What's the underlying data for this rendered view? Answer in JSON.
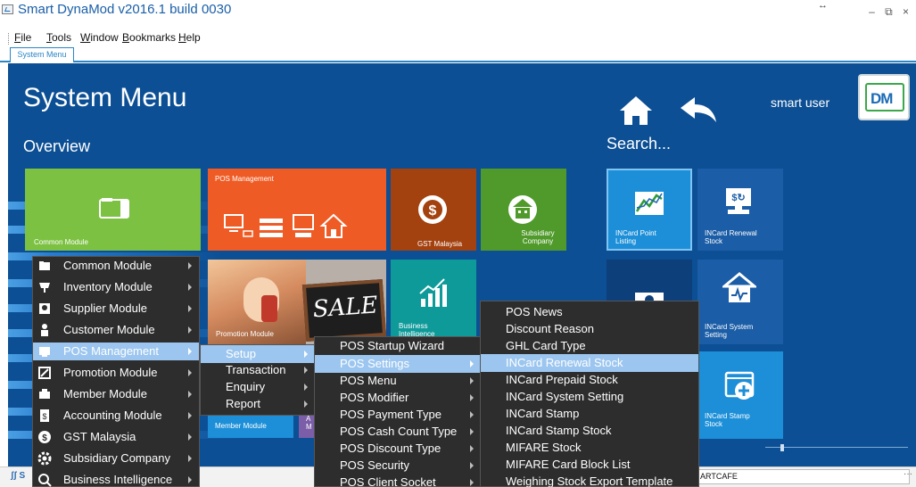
{
  "window": {
    "title": "Smart DynaMod v2016.1 build 0030",
    "resize_glyph": "↔",
    "controls": "– ⧉ ×"
  },
  "menubar": {
    "items": [
      {
        "label": "File",
        "u": "F",
        "rest": "ile"
      },
      {
        "label": "Tools",
        "u": "T",
        "rest": "ools"
      },
      {
        "label": "Window",
        "u": "W",
        "rest": "indow"
      },
      {
        "label": "Bookmarks",
        "u": "B",
        "rest": "ookmarks"
      },
      {
        "label": "Help",
        "u": "H",
        "rest": "elp"
      }
    ]
  },
  "tabs": [
    "System Menu"
  ],
  "header": {
    "title": "System Menu",
    "overview": "Overview",
    "search": "Search...",
    "user": "smart user",
    "logo_text": "DM"
  },
  "tiles": {
    "common_module": "Common Module",
    "pos_management": "POS Management",
    "gst_malaysia": "GST Malaysia",
    "subsidiary_company_1": "Subsidiary",
    "subsidiary_company_2": "Company",
    "incard_point_1": "INCard Point",
    "incard_point_2": "Listing",
    "incard_renewal_1": "INCard Renewal",
    "incard_renewal_2": "Stock",
    "promotion_module": "Promotion Module",
    "sale_sign": "SALE",
    "business_1": "Business",
    "business_2": "Intelligence",
    "incard_system_1": "INCard System",
    "incard_system_2": "Setting",
    "incard_stamp_1": "INCard Stamp",
    "incard_stamp_2": "Stock",
    "member_module": "Member Module",
    "partial_a": "A",
    "partial_m": "M"
  },
  "menu_main": {
    "items": [
      {
        "label": "Common Module",
        "icon": "folder-icon"
      },
      {
        "label": "Inventory Module",
        "icon": "cart-icon"
      },
      {
        "label": "Supplier Module",
        "icon": "supplier-icon"
      },
      {
        "label": "Customer Module",
        "icon": "person-icon"
      },
      {
        "label": "POS Management",
        "icon": "pos-icon",
        "selected": true
      },
      {
        "label": "Promotion Module",
        "icon": "promotion-icon"
      },
      {
        "label": "Member Module",
        "icon": "member-icon"
      },
      {
        "label": "Accounting Module",
        "icon": "accounting-icon"
      },
      {
        "label": "GST Malaysia",
        "icon": "dollar-icon"
      },
      {
        "label": "Subsidiary Company",
        "icon": "gear-icon"
      },
      {
        "label": "Business Intelligence",
        "icon": "bi-icon"
      }
    ]
  },
  "menu_pos": {
    "items": [
      {
        "label": "Setup",
        "selected": true
      },
      {
        "label": "Transaction"
      },
      {
        "label": "Enquiry"
      },
      {
        "label": "Report"
      }
    ]
  },
  "menu_setup": {
    "items": [
      {
        "label": "POS Startup Wizard"
      },
      {
        "label": "POS Settings",
        "selected": true
      },
      {
        "label": "POS Menu"
      },
      {
        "label": "POS Modifier"
      },
      {
        "label": "POS Payment Type"
      },
      {
        "label": "POS Cash Count Type"
      },
      {
        "label": "POS Discount Type"
      },
      {
        "label": "POS Security"
      },
      {
        "label": "POS Client Socket"
      }
    ]
  },
  "menu_settings": {
    "items": [
      {
        "label": "POS News"
      },
      {
        "label": "Discount Reason"
      },
      {
        "label": "GHL Card Type"
      },
      {
        "label": "INCard Renewal Stock",
        "selected": true
      },
      {
        "label": "INCard Prepaid Stock"
      },
      {
        "label": "INCard System Setting"
      },
      {
        "label": "INCard Stamp"
      },
      {
        "label": "INCard Stamp Stock"
      },
      {
        "label": "MIFARE Stock"
      },
      {
        "label": "MIFARE Card Block List"
      },
      {
        "label": "Weighing Stock Export Template"
      }
    ]
  },
  "statusbar": {
    "left_icons": "ʃʃ S",
    "right_text": "ARTCAFE",
    "dots": "···"
  },
  "colors": {
    "main_bg": "#0c4f94",
    "tile_green": "#7cc142",
    "tile_orange": "#ef5b25",
    "tile_brown": "#a3410f",
    "tile_olive": "#4f9a2a",
    "tile_blue": "#1c8fd8",
    "tile_navy": "#0d3f7a",
    "menu_bg": "#2d2d2d",
    "menu_selected": "#9cc6ef"
  }
}
